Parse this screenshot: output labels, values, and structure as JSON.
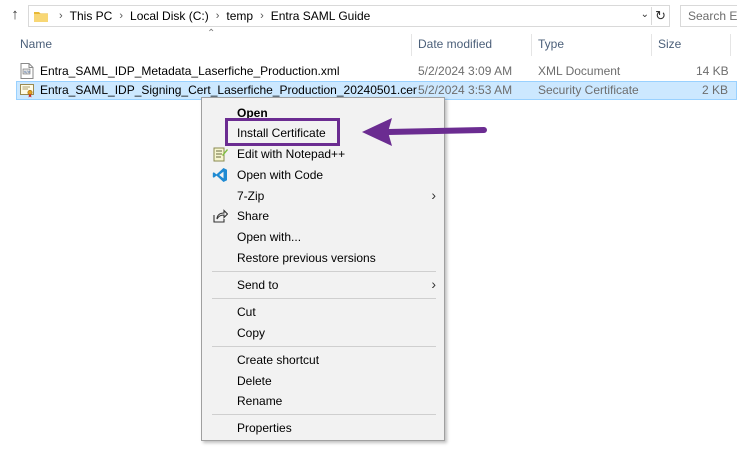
{
  "address_bar": {
    "breadcrumbs": [
      "This PC",
      "Local Disk (C:)",
      "temp",
      "Entra SAML Guide"
    ],
    "search_placeholder": "Search Er"
  },
  "columns": {
    "name": "Name",
    "date_modified": "Date modified",
    "type": "Type",
    "size": "Size"
  },
  "files": [
    {
      "name": "Entra_SAML_IDP_Metadata_Laserfiche_Production.xml",
      "date_modified": "5/2/2024 3:09 AM",
      "type": "XML Document",
      "size": "14 KB",
      "icon": "xml-file-icon"
    },
    {
      "name": "Entra_SAML_IDP_Signing_Cert_Laserfiche_Production_20240501.cer",
      "date_modified": "5/2/2024 3:53 AM",
      "type": "Security Certificate",
      "size": "2 KB",
      "icon": "certificate-file-icon",
      "selected": true
    }
  ],
  "context_menu": {
    "items": [
      {
        "label": "Open",
        "bold": true
      },
      {
        "label": "Install Certificate",
        "highlighted": true
      },
      {
        "label": "Edit with Notepad++",
        "icon": "notepad-plus-plus-icon"
      },
      {
        "label": "Open with Code",
        "icon": "vscode-icon"
      },
      {
        "label": "7-Zip",
        "submenu": true
      },
      {
        "label": "Share",
        "icon": "share-icon"
      },
      {
        "label": "Open with..."
      },
      {
        "label": "Restore previous versions"
      },
      {
        "label": "Send to",
        "submenu": true
      },
      {
        "label": "Cut"
      },
      {
        "label": "Copy"
      },
      {
        "label": "Create shortcut"
      },
      {
        "label": "Delete"
      },
      {
        "label": "Rename"
      },
      {
        "label": "Properties"
      }
    ]
  },
  "colors": {
    "selection_bg": "#cce8ff",
    "selection_border": "#99d1ff",
    "annotation_purple": "#6b2c91",
    "header_text": "#4c607a"
  }
}
